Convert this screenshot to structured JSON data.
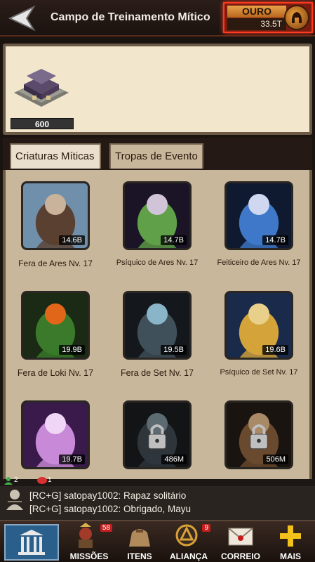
{
  "header": {
    "title": "Campo de Treinamento Mítico",
    "gold_label": "OURO",
    "gold_value": "33.5T"
  },
  "banner": {
    "level": "600"
  },
  "tabs": [
    {
      "label": "Criaturas Míticas"
    },
    {
      "label": "Tropas de Evento"
    }
  ],
  "cards": [
    {
      "name": "Fera de Ares Nv. 17",
      "power": "14.6B",
      "locked": false,
      "theme": "bear"
    },
    {
      "name": "Psíquico de Ares Nv. 17",
      "power": "14.7B",
      "locked": false,
      "theme": "psychic"
    },
    {
      "name": "Feiticeiro de Ares Nv. 17",
      "power": "14.7B",
      "locked": false,
      "theme": "wizard"
    },
    {
      "name": "Fera de Loki Nv. 17",
      "power": "19.9B",
      "locked": false,
      "theme": "loki"
    },
    {
      "name": "Fera de Set Nv. 17",
      "power": "19.5B",
      "locked": false,
      "theme": "serpent"
    },
    {
      "name": "Psíquico de Set Nv. 17",
      "power": "19.6B",
      "locked": false,
      "theme": "pharaoh"
    },
    {
      "name": "",
      "power": "19.7B",
      "locked": false,
      "theme": "sorceress"
    },
    {
      "name": "",
      "power": "486M",
      "locked": true,
      "theme": "serpent-dark"
    },
    {
      "name": "",
      "power": "506M",
      "locked": true,
      "theme": "warrior"
    }
  ],
  "chat": {
    "online_count": "2",
    "message_count": "1",
    "lines": [
      "[RC+G] satopay1002: Rapaz solitário",
      "[RC+G] satopay1002: Obrigado, Mayu"
    ]
  },
  "nav": {
    "missions": {
      "label": "MISSÕES",
      "badge": "58"
    },
    "items": {
      "label": "ITENS"
    },
    "alliance": {
      "label": "ALIANÇA",
      "badge": "9"
    },
    "mail": {
      "label": "CORREIO"
    },
    "more": {
      "label": "MAIS"
    }
  }
}
